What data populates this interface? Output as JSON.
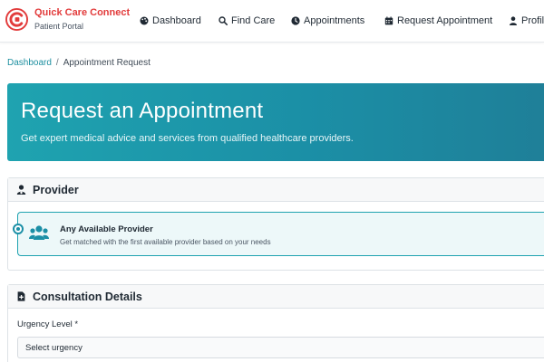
{
  "brand": {
    "name": "Quick Care Connect",
    "subtitle": "Patient Portal",
    "accent_color": "#e23b3b"
  },
  "nav": {
    "items": [
      {
        "label": "Dashboard",
        "icon": "palette-icon"
      },
      {
        "label": "Find Care",
        "icon": "search-icon"
      },
      {
        "label": "Appointments",
        "icon": "clock-icon"
      },
      {
        "label": "Request Appointment",
        "icon": "calendar-icon"
      },
      {
        "label": "Profile",
        "icon": "user-icon"
      }
    ]
  },
  "breadcrumb": {
    "home": "Dashboard",
    "separator": "/",
    "current": "Appointment Request"
  },
  "hero": {
    "title": "Request an Appointment",
    "subtitle": "Get expert medical advice and services from qualified healthcare providers.",
    "color": "#1b8fa6"
  },
  "provider_section": {
    "title": "Provider",
    "icon": "user-doctor-icon",
    "option": {
      "name": "Any Available Provider",
      "description": "Get matched with the first available provider based on your needs",
      "icon": "users-icon",
      "selected": true
    }
  },
  "consultation_section": {
    "title": "Consultation Details",
    "icon": "file-medical-icon",
    "urgency": {
      "label": "Urgency Level *",
      "selected_value": "Select urgency"
    }
  }
}
